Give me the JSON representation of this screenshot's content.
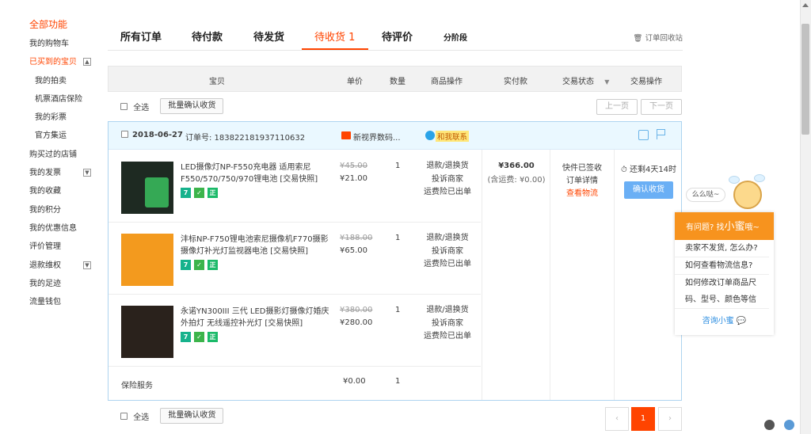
{
  "sidebar": {
    "heading": "全部功能",
    "items": [
      {
        "label": "我的购物车",
        "sub": false,
        "active": false,
        "toggle": ""
      },
      {
        "label": "已买到的宝贝",
        "sub": false,
        "active": true,
        "toggle": "▲"
      },
      {
        "label": "我的拍卖",
        "sub": true,
        "active": false,
        "toggle": ""
      },
      {
        "label": "机票酒店保险",
        "sub": true,
        "active": false,
        "toggle": ""
      },
      {
        "label": "我的彩票",
        "sub": true,
        "active": false,
        "toggle": ""
      },
      {
        "label": "官方集运",
        "sub": true,
        "active": false,
        "toggle": ""
      },
      {
        "label": "购买过的店铺",
        "sub": false,
        "active": false,
        "toggle": ""
      },
      {
        "label": "我的发票",
        "sub": false,
        "active": false,
        "toggle": "▼"
      },
      {
        "label": "我的收藏",
        "sub": false,
        "active": false,
        "toggle": ""
      },
      {
        "label": "我的积分",
        "sub": false,
        "active": false,
        "toggle": ""
      },
      {
        "label": "我的优惠信息",
        "sub": false,
        "active": false,
        "toggle": ""
      },
      {
        "label": "评价管理",
        "sub": false,
        "active": false,
        "toggle": ""
      },
      {
        "label": "退款维权",
        "sub": false,
        "active": false,
        "toggle": "▼"
      },
      {
        "label": "我的足迹",
        "sub": false,
        "active": false,
        "toggle": ""
      },
      {
        "label": "流量钱包",
        "sub": false,
        "active": false,
        "toggle": ""
      }
    ]
  },
  "tabs": {
    "all": "所有订单",
    "unpaid": "待付款",
    "unshipped": "待发货",
    "to_receive": "待收货 1",
    "to_review": "待评价",
    "installment": "分阶段",
    "recycle": "订单回收站"
  },
  "table_header": {
    "item": "宝贝",
    "unit_price": "单价",
    "quantity": "数量",
    "item_ops": "商品操作",
    "paid": "实付款",
    "status": "交易状态",
    "status_toggle": "▼",
    "trade_ops": "交易操作"
  },
  "batch": {
    "select_all": "全选",
    "confirm_batch": "批量确认收货",
    "prev_page": "上一页",
    "next_page": "下一页"
  },
  "order": {
    "date": "2018-06-27",
    "order_no": "订单号: 183822181937110632",
    "shop_name": "新视界数码...",
    "chat": "和我联系",
    "paid_amount": "¥366.00",
    "shipping_note": "(含运费: ¥0.00)",
    "status_lines": [
      "快件已签收",
      "订单详情"
    ],
    "logistics_link": "查看物流",
    "remaining_time": "还剩4天14时",
    "confirm_button": "确认收货",
    "items": [
      {
        "title": "LED摄像灯NP-F550充电器 适用索尼F550/570/750/970锂电池 [交易快照]",
        "price_old": "¥45.00",
        "price_new": "¥21.00",
        "qty": "1",
        "ops": [
          "退款/退换货",
          "投诉商家",
          "运费险已出单"
        ]
      },
      {
        "title": "沣标NP-F750锂电池索尼摄像机F770摄影摄像灯补光灯监视器电池 [交易快照]",
        "price_old": "¥188.00",
        "price_new": "¥65.00",
        "qty": "1",
        "ops": [
          "退款/退换货",
          "投诉商家",
          "运费险已出单"
        ]
      },
      {
        "title": "永诺YN300III 三代 LED摄影灯摄像灯婚庆外拍灯 无线遥控补光灯 [交易快照]",
        "price_old": "¥380.00",
        "price_new": "¥280.00",
        "qty": "1",
        "ops": [
          "退款/退换货",
          "投诉商家",
          "运费险已出单"
        ]
      }
    ],
    "item_icon_labels": [
      "7",
      "✓",
      "正"
    ],
    "insurance": {
      "label": "保险服务",
      "price": "¥0.00",
      "qty": "1"
    }
  },
  "pagination": {
    "prev": "‹",
    "current": "1",
    "next": "›"
  },
  "helper": {
    "speech": "么么哒~",
    "title_prefix": "有问题? 找",
    "title_name": "小蜜",
    "title_suffix": "哦~",
    "questions": [
      "卖家不发货, 怎么办?",
      "如何查看物流信息?",
      "如何修改订单商品尺",
      "码、型号、颜色等信"
    ],
    "consult": "咨询小蜜"
  },
  "colors": {
    "accent": "#ff4400",
    "link_blue": "#2a8ce0",
    "confirm_blue": "#6aaff5",
    "helper_orange": "#f7931e"
  }
}
